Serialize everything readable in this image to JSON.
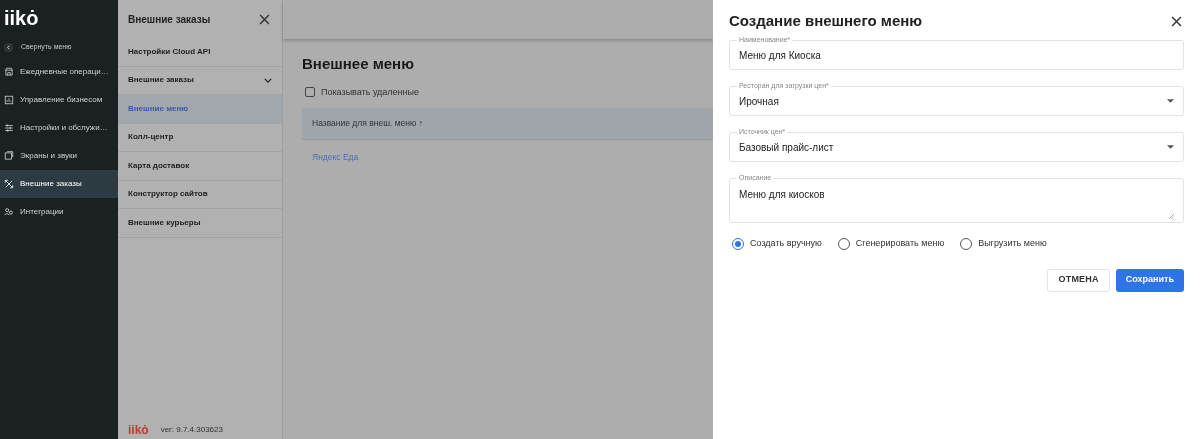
{
  "sidebar": {
    "logo": "iikȯ",
    "collapse": "Свернуть меню",
    "items": [
      {
        "label": "Ежедневные операци…",
        "selected": false
      },
      {
        "label": "Управление бизнесом",
        "selected": false
      },
      {
        "label": "Настройки и обслужи…",
        "selected": false
      },
      {
        "label": "Экраны и звуки",
        "selected": false
      },
      {
        "label": "Внешние заказы",
        "selected": true
      },
      {
        "label": "Интеграции",
        "selected": false
      }
    ]
  },
  "submenu": {
    "title": "Внешние заказы",
    "items": [
      {
        "label": "Настройки Cloud API",
        "expandable": false,
        "selected": false
      },
      {
        "label": "Внешние заказы",
        "expandable": true,
        "selected": false
      },
      {
        "label": "Внешние меню",
        "expandable": false,
        "selected": true
      },
      {
        "label": "Колл-центр",
        "expandable": false,
        "selected": false
      },
      {
        "label": "Карта доставок",
        "expandable": false,
        "selected": false
      },
      {
        "label": "Конструктор сайтов",
        "expandable": false,
        "selected": false
      },
      {
        "label": "Внешние курьеры",
        "expandable": false,
        "selected": false
      }
    ],
    "footer_logo": "iikȯ",
    "version": "ver: 9.7.4.303623"
  },
  "main": {
    "title": "Внешнее меню",
    "show_deleted": {
      "label": "Показывать удаленные",
      "checked": false
    },
    "table": {
      "columns": [
        "Название для внеш. меню ↑"
      ],
      "rows": [
        "Яндекс Еда"
      ]
    }
  },
  "dialog": {
    "title": "Создание внешнего меню",
    "fields": [
      {
        "kind": "input",
        "label": "Наименование*",
        "value": "Меню для Киоска"
      },
      {
        "kind": "select",
        "label": "Ресторан для загрузки цен*",
        "value": "Ирочная"
      },
      {
        "kind": "select",
        "label": "Источник цен*",
        "value": "Базовый прайс-лист"
      },
      {
        "kind": "textarea",
        "label": "Описание",
        "value": "Меню для киосков"
      }
    ],
    "modes": [
      {
        "label": "Создать вручную",
        "selected": true
      },
      {
        "label": "Сгенерировать меню",
        "selected": false
      },
      {
        "label": "Выгрузить меню",
        "selected": false
      }
    ],
    "buttons": [
      {
        "kind": "secondary",
        "label": "ОТМЕНА"
      },
      {
        "kind": "primary",
        "label": "Сохранить"
      }
    ]
  }
}
